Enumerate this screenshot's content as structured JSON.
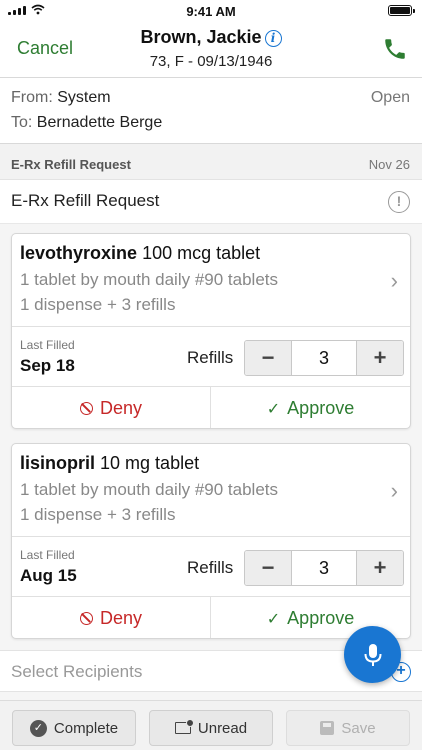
{
  "status_bar": {
    "time": "9:41 AM"
  },
  "header": {
    "cancel_label": "Cancel",
    "patient_name": "Brown, Jackie",
    "patient_details": "73, F - 09/13/1946"
  },
  "message": {
    "from_label": "From:",
    "from_value": "System",
    "to_label": "To:",
    "to_value": "Bernadette Berge",
    "status": "Open",
    "section_title": "E-Rx Refill Request",
    "section_date": "Nov 26",
    "subject": "E-Rx Refill Request"
  },
  "medications": [
    {
      "name": "levothyroxine",
      "strength": "100 mcg tablet",
      "sig": "1 tablet by mouth daily #90 tablets",
      "dispense": "1 dispense + 3 refills",
      "last_filled_label": "Last Filled",
      "last_filled": "Sep 18",
      "refills_label": "Refills",
      "refills": "3",
      "deny_label": "Deny",
      "approve_label": "Approve"
    },
    {
      "name": "lisinopril",
      "strength": "10 mg tablet",
      "sig": "1 tablet by mouth daily #90 tablets",
      "dispense": "1 dispense + 3 refills",
      "last_filled_label": "Last Filled",
      "last_filled": "Aug 15",
      "refills_label": "Refills",
      "refills": "3",
      "deny_label": "Deny",
      "approve_label": "Approve"
    }
  ],
  "recipients": {
    "placeholder": "Select Recipients"
  },
  "footer": {
    "complete_label": "Complete",
    "unread_label": "Unread",
    "save_label": "Save"
  },
  "colors": {
    "accent_green": "#2e7d32",
    "deny_red": "#c62828",
    "info_blue": "#1976d2"
  }
}
